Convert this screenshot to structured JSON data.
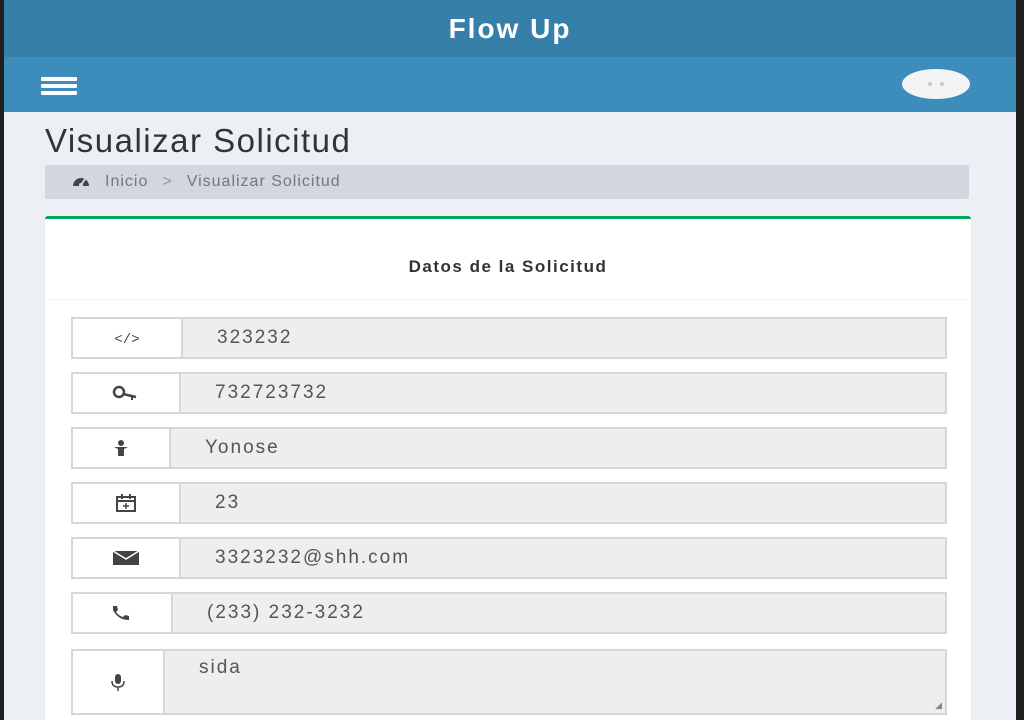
{
  "header": {
    "brand": "Flow Up"
  },
  "navbar": {
    "menu_icon": "hamburger-icon",
    "avatar_icon": "avatar-icon"
  },
  "page": {
    "title": "Visualizar Solicitud"
  },
  "breadcrumb": {
    "icon": "dashboard-icon",
    "home": "Inicio",
    "separator": ">",
    "current": "Visualizar Solicitud"
  },
  "box": {
    "title": "Datos de la Solicitud",
    "accent_color": "#00a65a"
  },
  "fields": [
    {
      "icon": "code-icon",
      "value": "323232"
    },
    {
      "icon": "key-icon",
      "value": "732723732"
    },
    {
      "icon": "user-icon",
      "value": "Yonose"
    },
    {
      "icon": "calendar-icon",
      "value": "23"
    },
    {
      "icon": "envelope-icon",
      "value": "3323232@shh.com"
    },
    {
      "icon": "phone-icon",
      "value": "(233) 232-3232"
    },
    {
      "icon": "microphone-icon",
      "value": "sida"
    }
  ],
  "colors": {
    "header": "#367fa9",
    "navbar": "#3c8dbc",
    "background": "#ecf0f5"
  }
}
